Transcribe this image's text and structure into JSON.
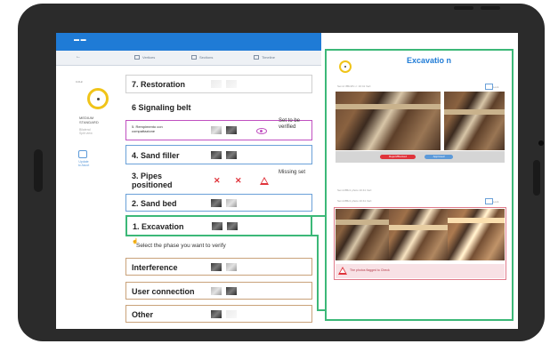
{
  "app": {
    "logo_text": "▬ ▬",
    "back_label": "←",
    "tabs": [
      {
        "label": "Vertices",
        "icon": "pin-icon"
      },
      {
        "label": "Sections",
        "icon": "ruler-icon"
      },
      {
        "label": "Timeline",
        "icon": "home-icon"
      }
    ]
  },
  "sidebar": {
    "status_label": "0-0Hc",
    "status_sub": "Ascot",
    "info_title": "MEDIUM\nSTANDARD",
    "info_sub": "Bilateral\nSplit view",
    "link": "Update\nto Ascot"
  },
  "phases": [
    {
      "label": "7. Restoration",
      "photos": "ghost"
    },
    {
      "label": "6 Signaling belt",
      "photos": "none"
    },
    {
      "label": "5. Rempimento con compattazione",
      "photos": "mixed",
      "status": "Set to be verified",
      "status_icon": "eye-icon"
    },
    {
      "label": "4. Sand filler",
      "photos": "dark"
    },
    {
      "label": "3. Pipes positioned",
      "photos": "missing",
      "status": "Missing set",
      "status_icon": "warning-icon"
    },
    {
      "label": "2. Sand bed",
      "photos": "mixed"
    },
    {
      "label": "1. Excavation",
      "photos": "dark",
      "selected": true
    }
  ],
  "hint": "Select the phase you want to verify",
  "extra_phases": [
    {
      "label": "Interference"
    },
    {
      "label": "User connection"
    },
    {
      "label": "Other"
    }
  ],
  "detail": {
    "title": "Excavatio n",
    "section1_caption": "Set id: 8Bc1Pc c: 10:41 Vert:",
    "section1_side": "Lock",
    "btn_reject": "Reject/Blocked",
    "btn_approve": "Approved",
    "section2_caption": "Set id 8Bc1 photo 10:41 Vert:",
    "section2_side": "Lock",
    "alert_text": "The photos flagged to Check"
  },
  "colors": {
    "primary": "#1f7bd6",
    "highlight_green": "#3cb878",
    "verify_purple": "#c050c0",
    "sand_blue": "#6aa0d8",
    "error_red": "#e0343b",
    "brown_border": "#c9a27a",
    "yellow": "#f0c419"
  }
}
